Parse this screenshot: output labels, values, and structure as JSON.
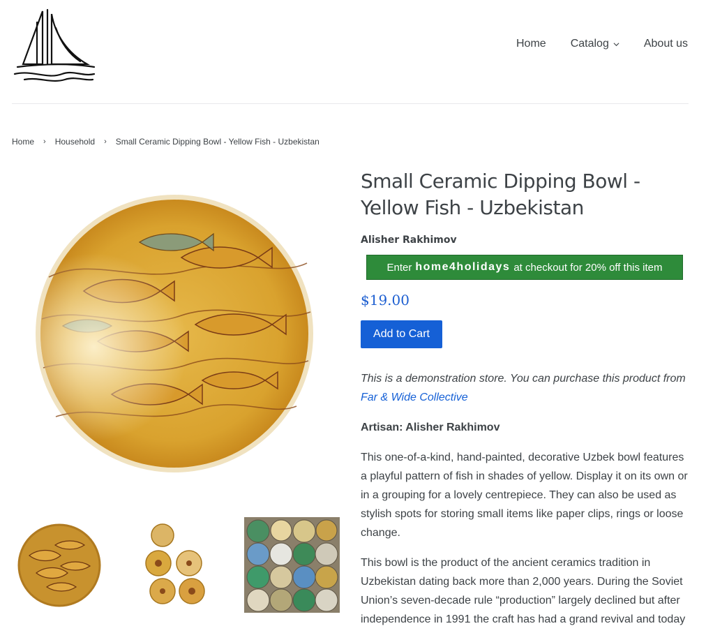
{
  "header": {
    "logo_alt": "sailboat logo",
    "nav": {
      "home": "Home",
      "catalog": "Catalog",
      "about": "About us"
    }
  },
  "breadcrumb": {
    "home": "Home",
    "household": "Household",
    "current": "Small Ceramic Dipping Bowl - Yellow Fish - Uzbekistan",
    "separator": "›"
  },
  "product": {
    "title": "Small Ceramic Dipping Bowl - Yellow Fish - Uzbekistan",
    "vendor": "Alisher Rakhimov",
    "promo": {
      "before": "Enter",
      "code": "home4holidays",
      "after": "at checkout for 20% off this item"
    },
    "price": "$19.00",
    "add_to_cart": "Add to Cart",
    "demo_text": "This is a demonstration store. You can purchase this product from",
    "demo_link": "Far & Wide Collective",
    "artisan": "Artisan: Alisher Rakhimov",
    "paragraph1": "This one-of-a-kind, hand-painted, decorative Uzbek bowl features a playful pattern of fish in shades of yellow. Display it on its own or in a grouping for a lovely centrepiece. They can also be used as stylish spots for storing small items like paper clips, rings or loose change.",
    "paragraph2": "This bowl is the product of the ancient ceramics tradition in Uzbekistan dating back more than 2,000 years. During the Soviet Union’s seven-decade rule “production” largely declined but after independence in 1991 the craft has had a grand revival and today"
  },
  "colors": {
    "accent": "#1560d6",
    "promo_bg": "#2e8b3a",
    "text": "#3d4246"
  },
  "icons": [
    "sailboat-logo-icon",
    "chevron-down-icon"
  ]
}
